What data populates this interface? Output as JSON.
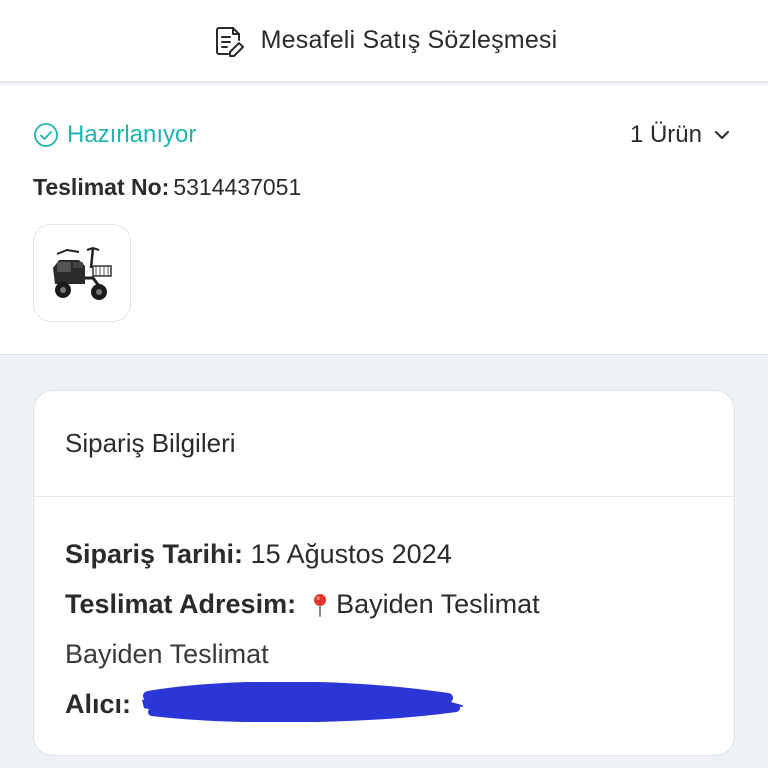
{
  "header": {
    "contract_label": "Mesafeli Satış Sözleşmesi",
    "contract_icon": "document-edit-icon"
  },
  "order": {
    "status": "Hazırlanıyor",
    "status_color": "#1fb5ad",
    "status_icon": "check-circle-icon",
    "items_count": "1 Ürün",
    "items_toggle_icon": "chevron-down-icon",
    "delivery_label": "Teslimat No:",
    "delivery_number": "5314437051",
    "product_image": "electric-tricycle-image"
  },
  "info": {
    "title": "Sipariş Bilgileri",
    "date_label": "Sipariş Tarihi:",
    "date_value": "15 Ağustos 2024",
    "address_label": "Teslimat Adresim:",
    "address_icon": "location-pin-icon",
    "address_value": "Bayiden Teslimat",
    "address_line": "Bayiden Teslimat",
    "recipient_label": "Alıcı:",
    "redaction_color": "#2a36d6"
  }
}
